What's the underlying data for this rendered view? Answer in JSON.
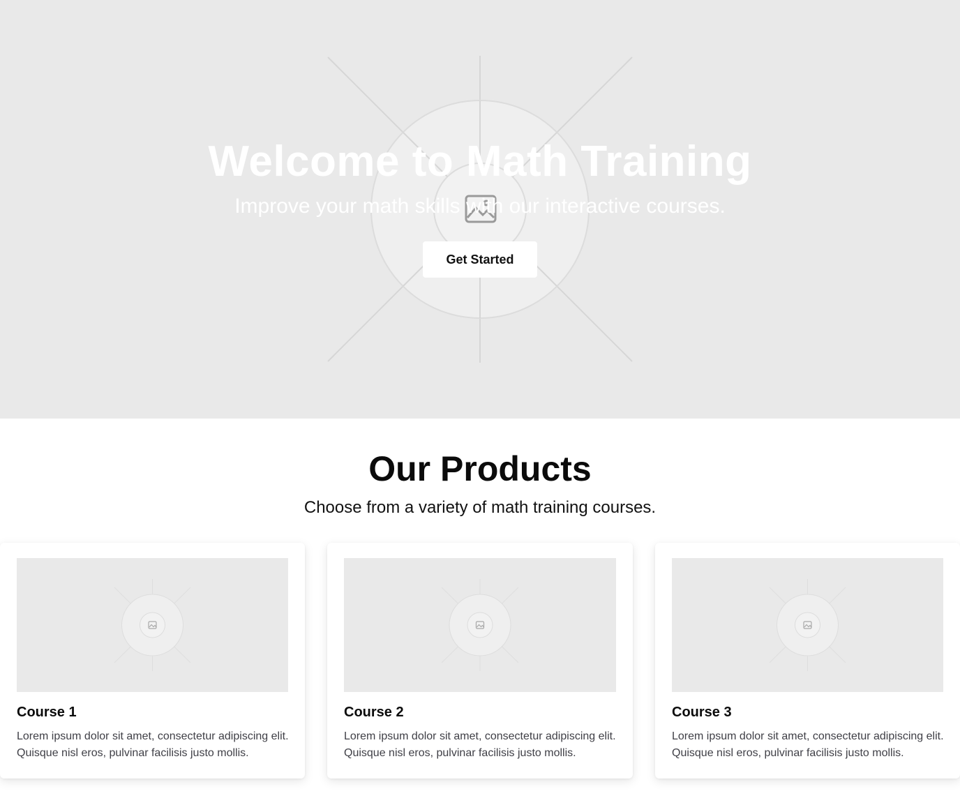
{
  "hero": {
    "title": "Welcome to Math Training",
    "subtitle": "Improve your math skills with our interactive courses.",
    "cta_label": "Get Started",
    "background_color": "#e9e9e9",
    "image_icon": "image-placeholder-icon"
  },
  "products": {
    "title": "Our Products",
    "subtitle": "Choose from a variety of math training courses.",
    "cards": [
      {
        "title": "Course 1",
        "description": "Lorem ipsum dolor sit amet, consectetur adipiscing elit. Quisque nisl eros, pulvinar facilisis justo mollis.",
        "image_icon": "image-placeholder-icon"
      },
      {
        "title": "Course 2",
        "description": "Lorem ipsum dolor sit amet, consectetur adipiscing elit. Quisque nisl eros, pulvinar facilisis justo mollis.",
        "image_icon": "image-placeholder-icon"
      },
      {
        "title": "Course 3",
        "description": "Lorem ipsum dolor sit amet, consectetur adipiscing elit. Quisque nisl eros, pulvinar facilisis justo mollis.",
        "image_icon": "image-placeholder-icon"
      }
    ]
  }
}
